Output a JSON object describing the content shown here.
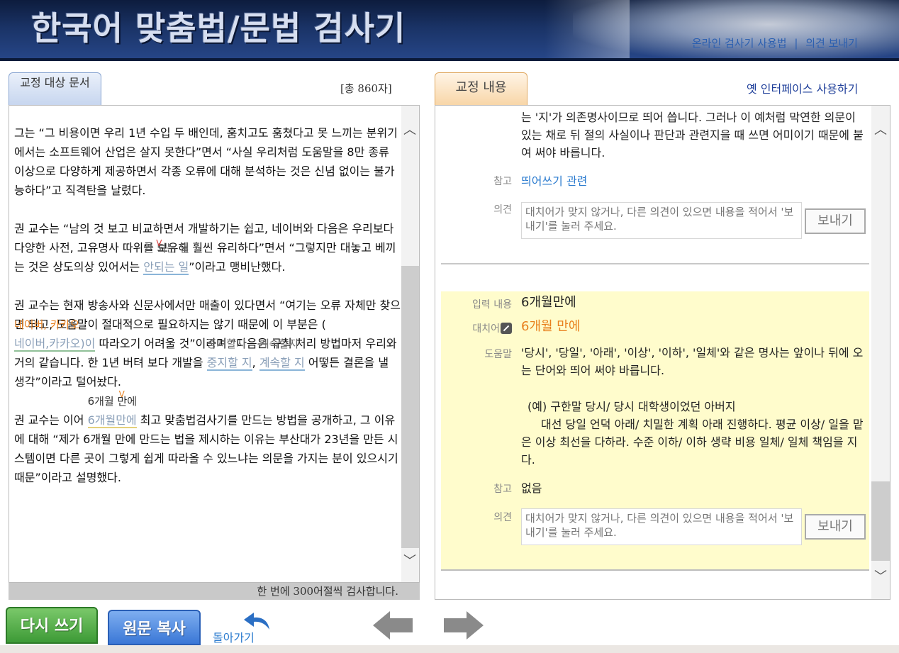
{
  "header": {
    "title": "한국어 맞춤법/문법 검사기",
    "link_usage": "온라인 검사기 사용법",
    "link_separator": "|",
    "link_feedback": "의견 보내기"
  },
  "left": {
    "tab_label": "교정 대상 문서",
    "char_count": "[총 860자]",
    "footer": "한 번에 300어절씩 검사합니다.",
    "paragraphs": {
      "p1": "그는 “그 비용이면 우리 1년 수입 두 배인데, 훔치고도 훔쳤다고 못 느끼는 분위기에서는 소프트웨어 산업은 살지 못한다”면서 “사실 우리처럼 도움말을 8만 종류 이상으로 다양하게 제공하면서 각종 오류에 대해 분석하는 것은 신념 없이는 불가능하다”고 직격탄을 날렸다.",
      "p2a": "권 교수는 “남의 것 보고 비교하면서 개발하기는 쉽고, 네이버와 다음은 우리보다 다양한 사전, 고유명사 따위를 보유해 훨씬 유리하다”면서 “그렇지만 대놓고 베끼는 것은 상도의상 있어서는 ",
      "p2_err": "안되는 일",
      "p2_sugg": "안 되는 일",
      "p2b": "”이라고 맹비난했다.",
      "p3a": "권 교수는 현재 방송사와 신문사에서만 매출이 있다면서 “여기는 오류 자체만 찾으면 되고, 도움말이 절대적으로 필요하지는 않기 때문에 이 부분은 (",
      "p3_err": "네이버,카카오)이",
      "p3_sugg": "네이버, 카카오",
      "p3b": " 따라오기 어려울 것”이라며 “다음은 규칙 처리 방법마저 우리와 거의 같습니다. 한 1년 버텨 보다 개발을 ",
      "p3_err2": "중지할 지",
      "p3_sugg2": "중지할지",
      "p3c": ", ",
      "p3_err3": "계속할 지",
      "p3_sugg3": "계속할지",
      "p3d": " 어떻든 결론을 낼 생각”이라고 털어놨다.",
      "p4a": "권 교수는 이어 ",
      "p4_err": "6개월만에",
      "p4_sugg": "6개월 만에",
      "p4b": " 최고 맞춤법검사기를 만드는 방법을 공개하고, 그 이유에 대해 “제가 6개월 만에 만드는 법을 제시하는 이유는 부산대가 23년을 만든 시스템이면 다른 곳이 그렇게 쉽게 따라올 수 있느냐는 의문을 가지는 분이 있으시기 때문”이라고 설명했다."
    }
  },
  "right": {
    "tab_label": "교정 내용",
    "old_interface": "옛 인터페이스 사용하기",
    "card1": {
      "help_text": "는 '지'가 의존명사이므로 띄어 씁니다. 그러나 이 예처럼 막연한 의문이 있는 채로 뒤 절의 사실이나 판단과 관련지을 때 쓰면 어미이기 때문에 붙여 써야 바릅니다.",
      "ref_label": "참고",
      "ref_value": "띄어쓰기 관련",
      "opinion_label": "의견",
      "opinion_placeholder": "대치어가 맞지 않거나, 다른 의견이 있으면 내용을 적어서 '보내기'를 눌러 주세요.",
      "send_label": "보내기"
    },
    "card2": {
      "input_label": "입력 내용",
      "input_value": "6개월만에",
      "replace_label": "대치어",
      "replace_value": "6개월 만에",
      "help_label": "도움말",
      "help_line1": "'당시', '당일', '아래', '이상', '이하', '일체'와 같은 명사는 앞이나 뒤에 오는 단어와 띄어 써야 바릅니다.",
      "example1": "(예) 구한말 당시/ 당시 대학생이었던 아버지",
      "example2": "대선 당일 언덕 아래/ 치밀한 계획 아래 진행하다. 평균 이상/ 일을 맡은 이상 최선을 다하라. 수준 이하/ 이하 생략 비용 일체/ 일체 책임을 지다.",
      "ref_label": "참고",
      "ref_value": "없음",
      "opinion_label": "의견",
      "opinion_placeholder": "대치어가 맞지 않거나, 다른 의견이 있으면 내용을 적어서 '보내기'를 눌러 주세요.",
      "send_label": "보내기"
    }
  },
  "bottom": {
    "rewrite_label": "다시 쓰기",
    "copy_label": "원문 복사",
    "back_label": "돌아가기"
  },
  "icons": {
    "scroll_up": "scroll-up-icon",
    "scroll_down": "scroll-down-icon",
    "back": "back-arrow-icon",
    "prev": "left-arrow-icon",
    "next": "right-arrow-icon",
    "pen": "pen-icon"
  },
  "colors": {
    "header_bg": "#1a3366",
    "highlight_card": "#fffccc",
    "suggestion_orange": "#e8801e",
    "rewrite_green": "#3d9a36",
    "copy_blue": "#3a77d6"
  }
}
